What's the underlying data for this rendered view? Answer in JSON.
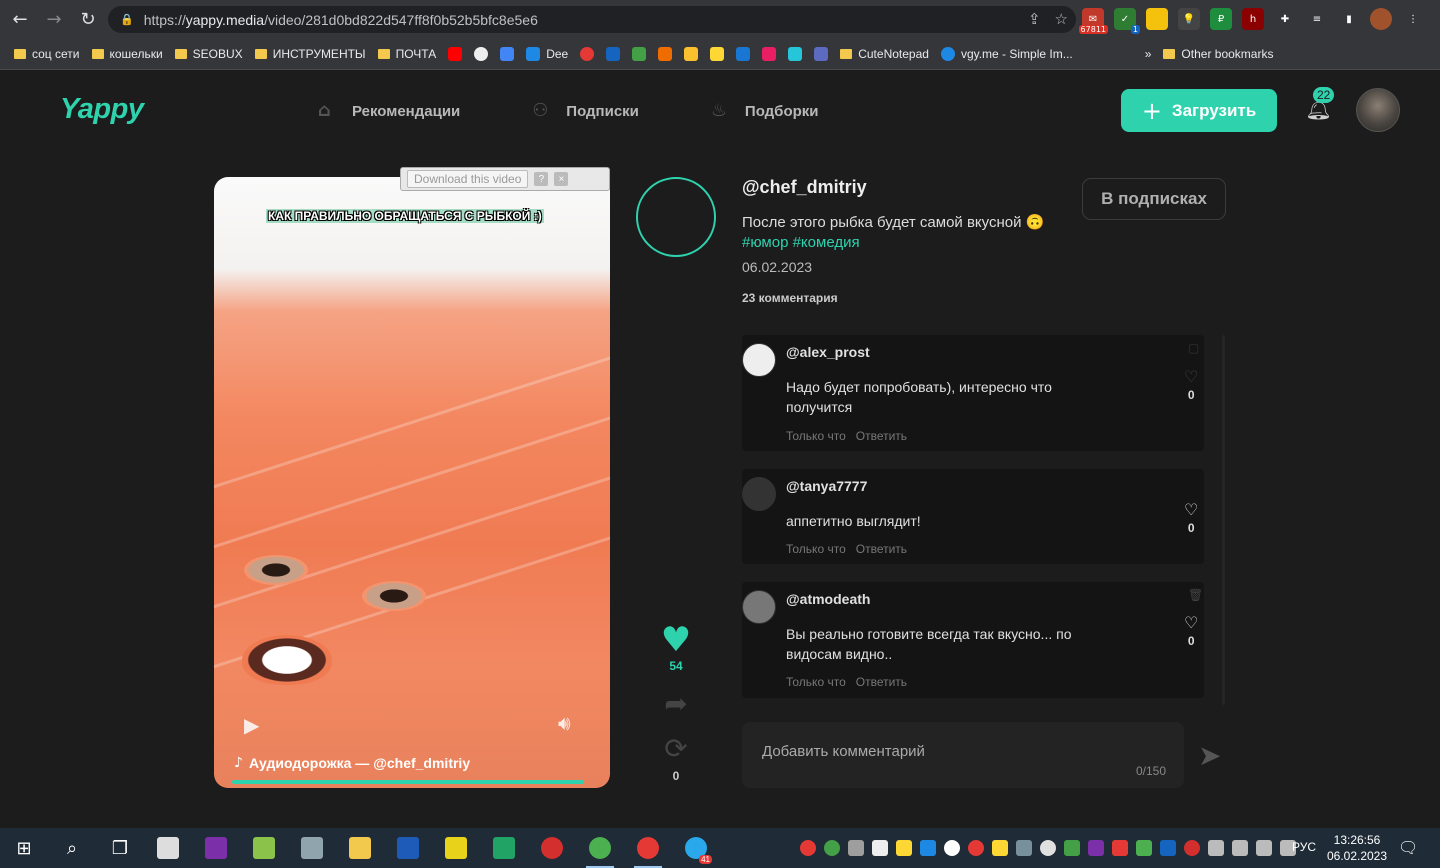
{
  "browser": {
    "url_prefix": "https://",
    "url_host": "yappy.media",
    "url_path": "/video/281d0bd822d547ff8f0b52b5bfc8e5e6",
    "ext_badge": "67811",
    "ext_badge2": "1"
  },
  "bookmarks": [
    {
      "label": "соц сети",
      "kind": "folder"
    },
    {
      "label": "кошельки",
      "kind": "folder"
    },
    {
      "label": "SEOBUX",
      "kind": "folder"
    },
    {
      "label": "ИНСТРУМЕНТЫ",
      "kind": "folder"
    },
    {
      "label": "ПОЧТА",
      "kind": "folder"
    },
    {
      "label": "Dee",
      "kind": "site"
    },
    {
      "label": "CuteNotepad",
      "kind": "folder"
    },
    {
      "label": "vgy.me - Simple Im...",
      "kind": "site"
    },
    {
      "label": "Other bookmarks",
      "kind": "folder"
    }
  ],
  "header": {
    "logo": "Yappy",
    "nav": [
      "Рекомендации",
      "Подписки",
      "Подборки"
    ],
    "upload_label": "Загрузить",
    "notifications_count": "22"
  },
  "video": {
    "download_label": "Download this video",
    "caption": "КАК ПРАВИЛЬНО ОБРАЩАТЬСЯ С РЫБКОЙ :)",
    "audio": "Аудиодорожка — @chef_dmitriy",
    "progress": 0.89
  },
  "actions": {
    "likes": "54",
    "reposts": "0"
  },
  "post": {
    "author": "@chef_dmitriy",
    "description": "После этого рыбка будет самой вкусной",
    "emoji": "🙃",
    "tags": [
      "#юмор",
      "#комедия"
    ],
    "date": "06.02.2023",
    "comments_count": "23 комментария",
    "subscribe_label": "В подписках"
  },
  "comments": [
    {
      "user": "@alex_prost",
      "text": "Надо будет попробовать), интересно что получится",
      "time": "Только что",
      "reply": "Ответить",
      "likes": "0"
    },
    {
      "user": "@tanya7777",
      "text": "аппетитно выглядит!",
      "time": "Только что",
      "reply": "Ответить",
      "likes": "0"
    },
    {
      "user": "@atmodeath",
      "text": "Вы реально готовите всегда так вкусно... по видосам  видно..",
      "time": "Только что",
      "reply": "Ответить",
      "likes": "0"
    }
  ],
  "comment_input": {
    "placeholder": "Добавить комментарий",
    "counter": "0/150"
  },
  "taskbar": {
    "lang": "РУС",
    "time": "13:26:56",
    "date": "06.02.2023",
    "telegram_badge": "41"
  }
}
